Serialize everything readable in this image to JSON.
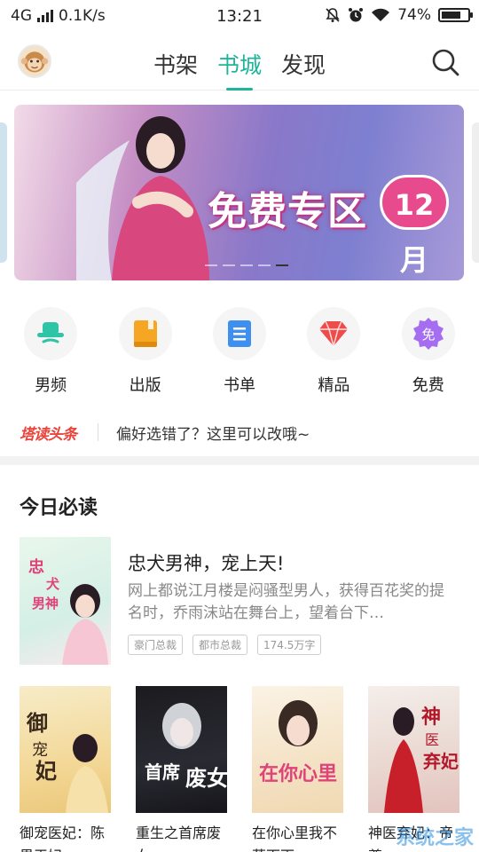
{
  "status_bar": {
    "network": "4G",
    "speed": "0.1K/s",
    "time": "13:21",
    "battery": "74%",
    "battery_level": 0.74
  },
  "header": {
    "tabs": [
      {
        "label": "书架",
        "active": false
      },
      {
        "label": "书城",
        "active": true
      },
      {
        "label": "发现",
        "active": false
      }
    ],
    "accent_color": "#1fb59b"
  },
  "banner": {
    "title": "免费专区",
    "month": "12月",
    "slide_count": 5,
    "active_slide": 5
  },
  "categories": [
    {
      "label": "男频",
      "icon": "male-hat-icon",
      "color": "#2ec4a6"
    },
    {
      "label": "出版",
      "icon": "book-icon",
      "color": "#f5a623"
    },
    {
      "label": "书单",
      "icon": "list-icon",
      "color": "#3d8ff0"
    },
    {
      "label": "精品",
      "icon": "gem-icon",
      "color": "#ee4b4b"
    },
    {
      "label": "免费",
      "icon": "free-badge-icon",
      "color": "#a56df0",
      "badge": "免"
    }
  ],
  "ticker": {
    "brand": "塔读头条",
    "text": "偏好选错了？这里可以改哦~"
  },
  "section": {
    "title": "今日必读"
  },
  "featured": {
    "title": "忠犬男神，宠上天!",
    "description": "网上都说江月楼是闷骚型男人，获得百花奖的提名时，乔雨沫站在舞台上，望着台下…",
    "tags": [
      "豪门总裁",
      "都市总裁",
      "174.5万字"
    ],
    "cover_text": "忠犬男神，宠上天!"
  },
  "grid_books": [
    {
      "name": "御宠医妃：陈界王妃",
      "cover_text": "御宠医妃"
    },
    {
      "name": "重生之首席废女",
      "cover_text": "首席废女"
    },
    {
      "name": "在你心里我不落下雨",
      "cover_text": "在你心里"
    },
    {
      "name": "神医弃妃：帝尊",
      "cover_text": "神医弃妃"
    }
  ],
  "watermark": "系统之家"
}
